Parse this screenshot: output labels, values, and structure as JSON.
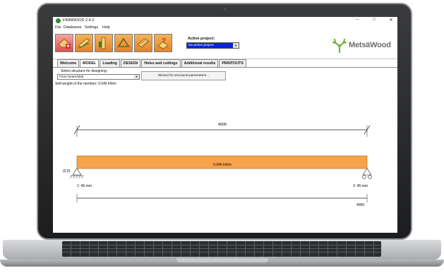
{
  "window": {
    "title": "FINNWOOD 2.4.2",
    "controls": [
      "–",
      "□",
      "✕"
    ]
  },
  "menu": [
    "File",
    "Databases",
    "Settings",
    "Help"
  ],
  "toolbar": {
    "buttons": [
      "new-project-icon",
      "beam-icon",
      "column-icon",
      "frame-icon",
      "panel-icon",
      "help-icon"
    ],
    "active_project_label": "Active project:",
    "active_project_value": "No active project",
    "logo_text": "MetsäWood",
    "logo_color": "#6db33f"
  },
  "tabs": [
    "Welcome",
    "MODEL",
    "Loading",
    "DESIGN",
    "Holes and cuttings",
    "Additional results",
    "PRINTOUTS"
  ],
  "model": {
    "structure_label": "Select structure for designing:",
    "structure_value": "Floor beam/slab",
    "wizard_button": "Wizard for structural parameters...",
    "self_weight": "Self-weight of the member: 0.046 kN/m"
  },
  "drawing": {
    "span_top": "4000",
    "load_label": "0.046 kN/m",
    "origin_label": "(0,0)",
    "support_left": "1: 45 mm",
    "support_right": "2: 45 mm",
    "span_bottom": "4000",
    "beam_color": "#f7a34b"
  }
}
